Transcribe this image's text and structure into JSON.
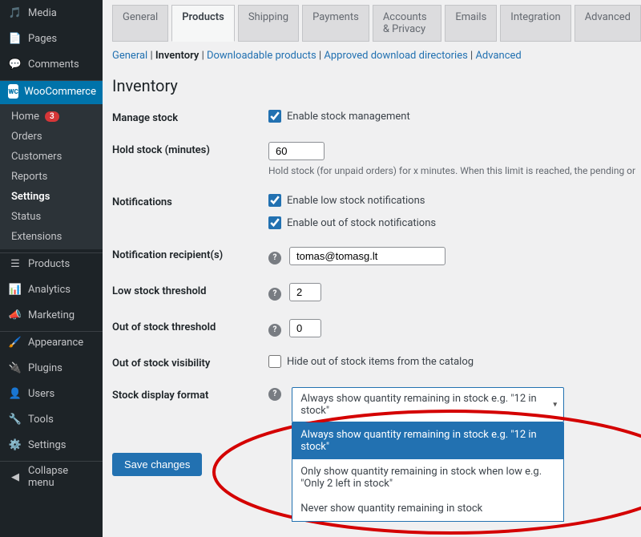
{
  "sidebar": {
    "top_items": [
      {
        "label": "Media",
        "icon": "media"
      },
      {
        "label": "Pages",
        "icon": "page"
      },
      {
        "label": "Comments",
        "icon": "comment"
      }
    ],
    "wc": {
      "label": "WooCommerce"
    },
    "wc_sub": [
      {
        "label": "Home",
        "badge": "3"
      },
      {
        "label": "Orders"
      },
      {
        "label": "Customers"
      },
      {
        "label": "Reports"
      },
      {
        "label": "Settings",
        "selected": true
      },
      {
        "label": "Status"
      },
      {
        "label": "Extensions"
      }
    ],
    "mid_items": [
      {
        "label": "Products",
        "icon": "products"
      },
      {
        "label": "Analytics",
        "icon": "analytics"
      },
      {
        "label": "Marketing",
        "icon": "marketing"
      }
    ],
    "bottom_items": [
      {
        "label": "Appearance",
        "icon": "appearance"
      },
      {
        "label": "Plugins",
        "icon": "plugins"
      },
      {
        "label": "Users",
        "icon": "users"
      },
      {
        "label": "Tools",
        "icon": "tools"
      },
      {
        "label": "Settings",
        "icon": "settings"
      }
    ],
    "collapse": "Collapse menu"
  },
  "tabs": [
    "General",
    "Products",
    "Shipping",
    "Payments",
    "Accounts & Privacy",
    "Emails",
    "Integration",
    "Advanced"
  ],
  "active_tab": "Products",
  "subtabs": [
    "General",
    "Inventory",
    "Downloadable products",
    "Approved download directories",
    "Advanced"
  ],
  "active_subtab": "Inventory",
  "page_title": "Inventory",
  "fields": {
    "manage_stock": {
      "label": "Manage stock",
      "checkbox": "Enable stock management",
      "checked": true
    },
    "hold_stock": {
      "label": "Hold stock (minutes)",
      "value": "60",
      "desc": "Hold stock (for unpaid orders) for x minutes. When this limit is reached, the pending or"
    },
    "notifications": {
      "label": "Notifications",
      "cb1": "Enable low stock notifications",
      "cb1_checked": true,
      "cb2": "Enable out of stock notifications",
      "cb2_checked": true
    },
    "recipient": {
      "label": "Notification recipient(s)",
      "value": "tomas@tomasg.lt"
    },
    "low_threshold": {
      "label": "Low stock threshold",
      "value": "2"
    },
    "oos_threshold": {
      "label": "Out of stock threshold",
      "value": "0"
    },
    "oos_visibility": {
      "label": "Out of stock visibility",
      "checkbox": "Hide out of stock items from the catalog",
      "checked": false
    },
    "stock_display": {
      "label": "Stock display format",
      "current": "Always show quantity remaining in stock e.g. \"12 in stock\"",
      "options": [
        "Always show quantity remaining in stock e.g. \"12 in stock\"",
        "Only show quantity remaining in stock when low e.g. \"Only 2 left in stock\"",
        "Never show quantity remaining in stock"
      ]
    }
  },
  "save_button": "Save changes"
}
